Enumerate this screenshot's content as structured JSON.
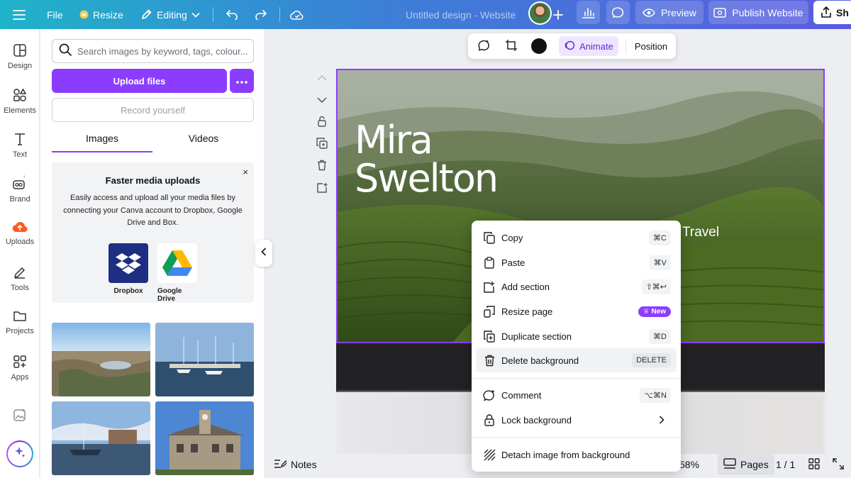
{
  "topbar": {
    "file_label": "File",
    "resize_label": "Resize",
    "editing_label": "Editing",
    "design_title": "Untitled design - Website",
    "preview_label": "Preview",
    "publish_label": "Publish Website",
    "share_label": "Sh",
    "resize_icon_color": "#f7c948"
  },
  "rail": {
    "items": [
      {
        "label": "Design",
        "icon": "design-icon"
      },
      {
        "label": "Elements",
        "icon": "elements-icon"
      },
      {
        "label": "Text",
        "icon": "text-icon"
      },
      {
        "label": "Brand",
        "icon": "brand-icon"
      },
      {
        "label": "Uploads",
        "icon": "upload-cloud-icon"
      },
      {
        "label": "Tools",
        "icon": "pen-icon"
      },
      {
        "label": "Projects",
        "icon": "folder-icon"
      },
      {
        "label": "Apps",
        "icon": "apps-icon"
      }
    ]
  },
  "panel": {
    "search_placeholder": "Search images by keyword, tags, colour...",
    "upload_label": "Upload files",
    "record_label": "Record yourself",
    "tabs": [
      "Images",
      "Videos"
    ],
    "promo": {
      "title": "Faster media uploads",
      "body": "Easily access and upload all your media files by connecting your Canva account to Dropbox, Google Drive and Box.",
      "close": "×",
      "services": [
        "Dropbox",
        "Google Drive"
      ]
    }
  },
  "floatbar": {
    "animate_label": "Animate",
    "position_label": "Position",
    "color_swatch": "#111111"
  },
  "design": {
    "hero_name_line1": "Mira",
    "hero_name_line2": "Swelton",
    "hero_sub_line1": "Travel"
  },
  "context_menu": {
    "items": [
      {
        "label": "Copy",
        "shortcut": "⌘C",
        "icon": "copy-icon"
      },
      {
        "label": "Paste",
        "shortcut": "⌘V",
        "icon": "paste-icon"
      },
      {
        "label": "Add section",
        "shortcut": "⇧⌘↩",
        "icon": "add-section-icon"
      },
      {
        "label": "Resize page",
        "badge": "New",
        "icon": "resize-page-icon"
      },
      {
        "label": "Duplicate section",
        "shortcut": "⌘D",
        "icon": "duplicate-icon"
      },
      {
        "label": "Delete background",
        "shortcut": "DELETE",
        "icon": "trash-icon"
      },
      {
        "label": "Comment",
        "shortcut": "⌥⌘N",
        "icon": "comment-icon"
      },
      {
        "label": "Lock background",
        "icon": "lock-icon"
      },
      {
        "label": "Detach image from background",
        "icon": "detach-icon"
      }
    ],
    "badge_color": "#8b3dff"
  },
  "bottombar": {
    "notes_label": "Notes",
    "zoom_partial": "58%",
    "pages_label": "Pages",
    "page_count": "1 / 1"
  },
  "colors": {
    "accent": "#8b3dff",
    "gradient_start": "#1fb3c9",
    "gradient_end": "#5b5be0"
  }
}
